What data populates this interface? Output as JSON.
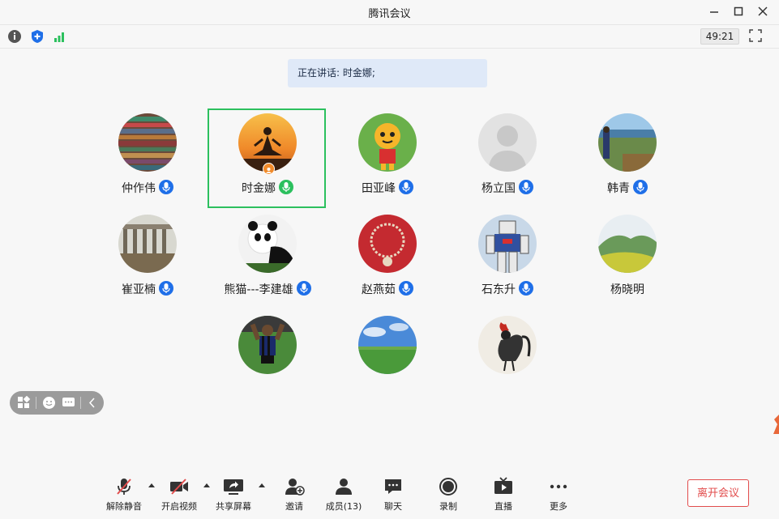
{
  "window": {
    "title": "腾讯会议"
  },
  "toolbar": {
    "timer": "49:21"
  },
  "speaking": {
    "text": "正在讲话: 时金娜;"
  },
  "participants": [
    {
      "name": "仲作伟",
      "avatar": "wood-stripes",
      "mic": true
    },
    {
      "name": "时金娜",
      "avatar": "meditation-silhouette",
      "mic": true,
      "active": true,
      "host": true
    },
    {
      "name": "田亚峰",
      "avatar": "cartoon-tiger",
      "mic": true
    },
    {
      "name": "杨立国",
      "avatar": "default-person",
      "mic": true
    },
    {
      "name": "韩青",
      "avatar": "lake-photo",
      "mic": true
    },
    {
      "name": "崔亚楠",
      "avatar": "colonnade",
      "mic": true
    },
    {
      "name": "熊猫---李建雄",
      "avatar": "panda",
      "mic": true
    },
    {
      "name": "赵燕茹",
      "avatar": "red-bracelet",
      "mic": true
    },
    {
      "name": "石东升",
      "avatar": "robot-statue",
      "mic": true
    },
    {
      "name": "杨晓明",
      "avatar": "hills-landscape",
      "mic": false
    },
    {
      "name": "",
      "avatar": "soccer-player",
      "mic": false
    },
    {
      "name": "",
      "avatar": "grassland",
      "mic": false
    },
    {
      "name": "",
      "avatar": "rooster-painting",
      "mic": false
    }
  ],
  "bottombar": {
    "unmute": "解除静音",
    "start_video": "开启视频",
    "share_screen": "共享屏幕",
    "invite": "邀请",
    "members": "成员(13)",
    "chat": "聊天",
    "record": "录制",
    "live": "直播",
    "more": "更多",
    "leave": "离开会议"
  },
  "colors": {
    "accent": "#1f6fe8",
    "active_border": "#2cc05e",
    "leave": "#e24c4c"
  }
}
